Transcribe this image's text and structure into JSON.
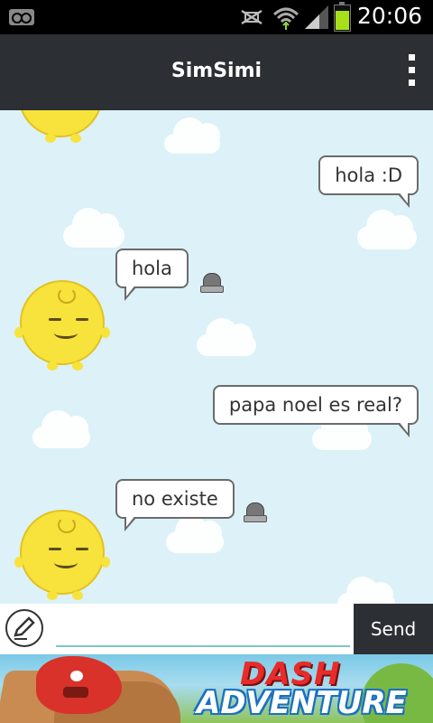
{
  "status_bar": {
    "time": "20:06",
    "icons": [
      "voicemail-icon",
      "nfc-icon",
      "wifi-icon",
      "signal-icon",
      "battery-icon"
    ],
    "battery_level": 0.8,
    "battery_color": "#a7e01a"
  },
  "header": {
    "title": "SimSimi",
    "menu_icon": "overflow-menu-icon",
    "background": "#2c2f33"
  },
  "chat": {
    "background": "#dcf1f8",
    "messages": [
      {
        "sender": "user",
        "text": "hola :D"
      },
      {
        "sender": "simsimi",
        "text": "hola"
      },
      {
        "sender": "user",
        "text": "papa noel es real?"
      },
      {
        "sender": "simsimi",
        "text": "no existe"
      }
    ]
  },
  "input": {
    "edit_icon": "pencil-icon",
    "value": "",
    "placeholder": "",
    "send_label": "Send"
  },
  "ad": {
    "line1": "DASH",
    "line2": "ADVENTURE"
  }
}
